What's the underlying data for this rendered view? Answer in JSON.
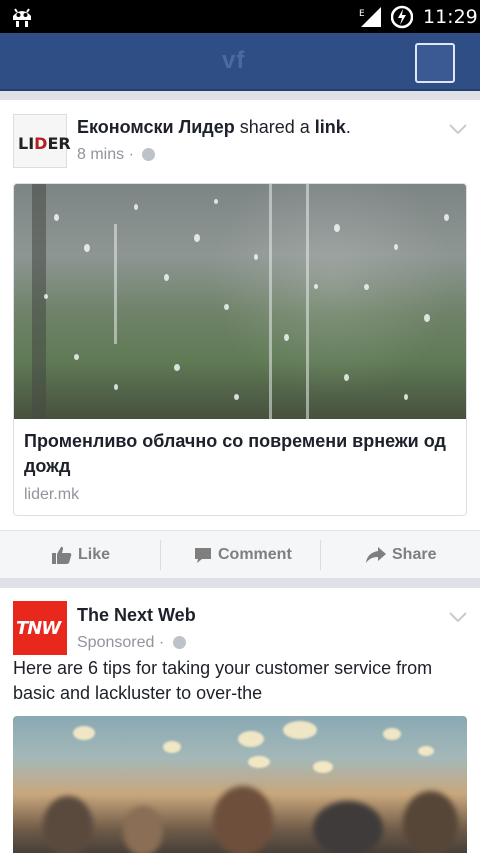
{
  "status_bar": {
    "time": "11:29",
    "network": "E"
  },
  "app_bar": {
    "logo": "vf"
  },
  "posts": [
    {
      "author": "Економски Лидер",
      "action_text": "shared a",
      "object": "link",
      "time": "8 mins",
      "avatar_text": "LIDER",
      "link": {
        "title": "Променливо облачно со повремени врнежи од дожд",
        "domain": "lider.mk"
      }
    },
    {
      "author": "The Next Web",
      "meta": "Sponsored",
      "avatar_text": "TNW",
      "text": "Here are 6 tips for taking your customer service from basic and lackluster to over-the"
    }
  ],
  "actions": {
    "like": "Like",
    "comment": "Comment",
    "share": "Share"
  },
  "icons": [
    "android-icon",
    "signal-icon",
    "battery-charging-icon",
    "menu-icon",
    "globe-icon",
    "chevron-down-icon",
    "like-icon",
    "comment-icon",
    "share-icon"
  ],
  "colors": {
    "app_bar": "#2f4e86",
    "brand_tnw": "#e9281d",
    "text_muted": "#90949c"
  }
}
